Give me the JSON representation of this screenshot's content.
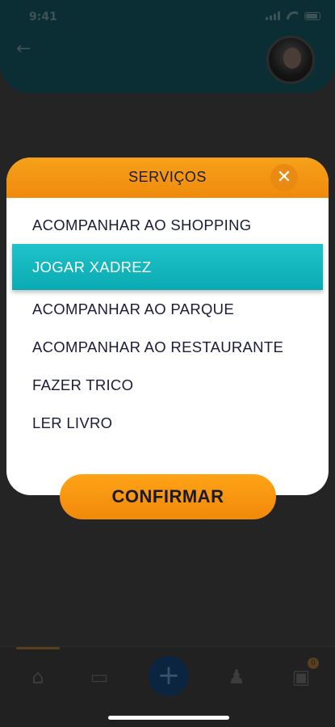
{
  "status_bar": {
    "time": "9:41",
    "icons": [
      "signal-icon",
      "wifi-icon",
      "battery-icon"
    ]
  },
  "header": {
    "back_icon": "arrow-left-icon",
    "avatar": "user-avatar"
  },
  "modal": {
    "title": "SERVIÇOS",
    "close_glyph": "✕",
    "items": [
      {
        "label": "ACOMPANHAR AO SHOPPING",
        "selected": false
      },
      {
        "label": "JOGAR XADREZ",
        "selected": true
      },
      {
        "label": "ACOMPANHAR AO PARQUE",
        "selected": false
      },
      {
        "label": "ACOMPANHAR AO RESTAURANTE",
        "selected": false
      },
      {
        "label": "FAZER TRICO",
        "selected": false
      },
      {
        "label": "LER LIVRO",
        "selected": false
      }
    ],
    "confirm_label": "CONFIRMAR"
  },
  "bottom_nav": {
    "items": [
      "home-icon",
      "calendar-icon",
      "add-icon",
      "notification-icon",
      "inbox-icon"
    ],
    "plus_glyph": "+",
    "badge": "0"
  },
  "colors": {
    "accent_orange": "#f39512",
    "selected_teal": "#12b6bd",
    "overlay": "#242424"
  }
}
